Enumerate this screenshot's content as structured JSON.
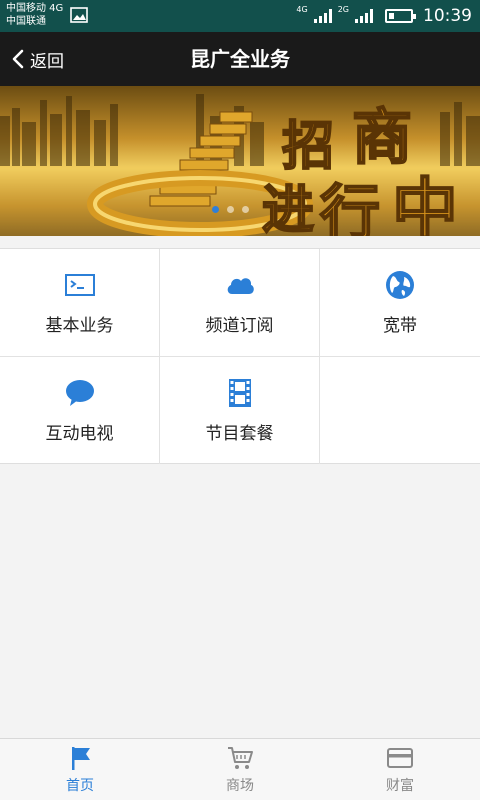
{
  "status_bar": {
    "carrier_1": "中国移动 4G",
    "carrier_2": "中国联通",
    "net_1": "4G",
    "net_2": "2G",
    "time": "10:39"
  },
  "header": {
    "back_label": "返回",
    "title": "昆广全业务"
  },
  "banner": {
    "slide_count": 3,
    "active_index": 0
  },
  "services": [
    {
      "label": "基本业务",
      "icon": "terminal-icon"
    },
    {
      "label": "频道订阅",
      "icon": "cloud-icon"
    },
    {
      "label": "宽带",
      "icon": "globe-icon"
    },
    {
      "label": "互动电视",
      "icon": "chat-bubble-icon"
    },
    {
      "label": "节目套餐",
      "icon": "film-icon"
    }
  ],
  "bottom_nav": [
    {
      "label": "首页",
      "icon": "flag-icon",
      "active": true
    },
    {
      "label": "商场",
      "icon": "cart-icon",
      "active": false
    },
    {
      "label": "财富",
      "icon": "card-icon",
      "active": false
    }
  ],
  "colors": {
    "accent": "#2b7fd7",
    "status_bar": "#12504c",
    "title_bar": "#1a1a1a"
  }
}
